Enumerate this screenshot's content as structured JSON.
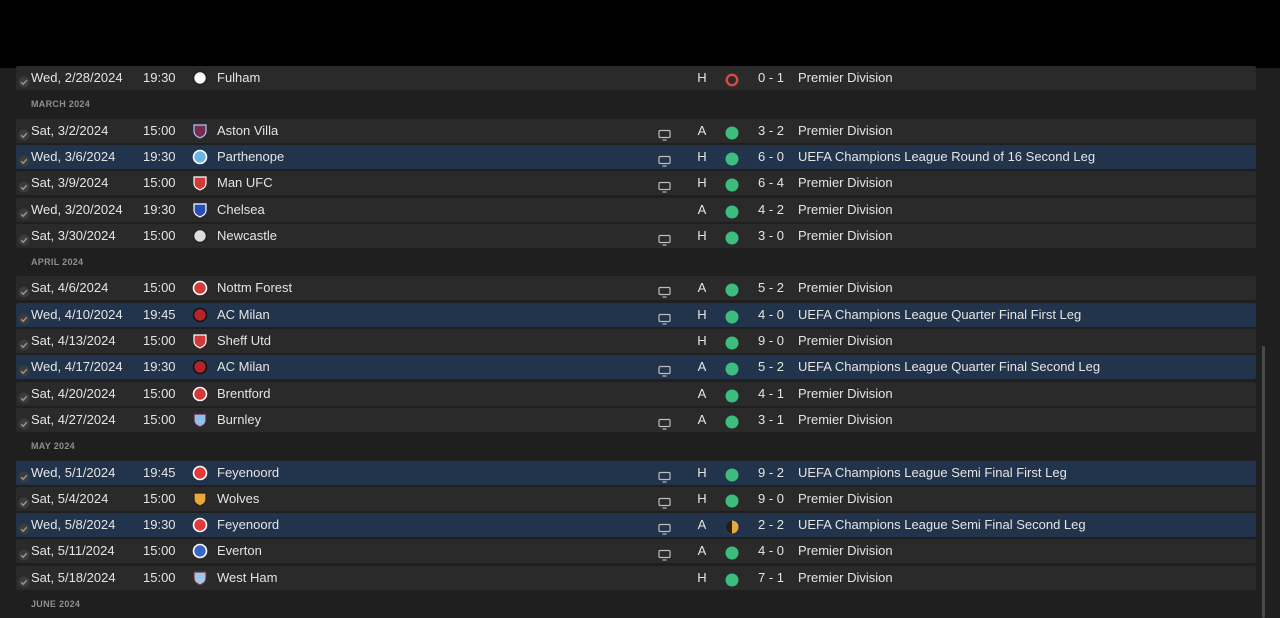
{
  "colors": {
    "win": "#3dbd7d",
    "draw": "#e6a93a",
    "loss": "#d24a4a",
    "row": "#2a2a2a",
    "row_highlight": "#22344c"
  },
  "entries": [
    {
      "kind": "match",
      "date": "Wed, 2/28/2024",
      "time": "19:30",
      "team": "Fulham",
      "crest": {
        "type": "circle",
        "fill": "#ffffff",
        "stroke": "#222222"
      },
      "tv": false,
      "venue": "H",
      "result": "loss",
      "score": "0 - 1",
      "competition": "Premier Division",
      "highlight": false
    },
    {
      "kind": "month",
      "label": "MARCH 2024"
    },
    {
      "kind": "match",
      "date": "Sat, 3/2/2024",
      "time": "15:00",
      "team": "Aston Villa",
      "crest": {
        "type": "shield",
        "fill": "#7a2a4a",
        "stroke": "#a8c8ff"
      },
      "tv": true,
      "venue": "A",
      "result": "win",
      "score": "3 - 2",
      "competition": "Premier Division",
      "highlight": false
    },
    {
      "kind": "match",
      "date": "Wed, 3/6/2024",
      "time": "19:30",
      "team": "Parthenope",
      "crest": {
        "type": "circle",
        "fill": "#6ab6e6",
        "stroke": "#ffffff"
      },
      "tv": true,
      "venue": "H",
      "result": "win",
      "score": "6 - 0",
      "competition": "UEFA Champions League Round of 16 Second Leg",
      "highlight": true
    },
    {
      "kind": "match",
      "date": "Sat, 3/9/2024",
      "time": "15:00",
      "team": "Man UFC",
      "crest": {
        "type": "shield",
        "fill": "#d23a3a",
        "stroke": "#ffffff"
      },
      "tv": true,
      "venue": "H",
      "result": "win",
      "score": "6 - 4",
      "competition": "Premier Division",
      "highlight": false
    },
    {
      "kind": "match",
      "date": "Wed, 3/20/2024",
      "time": "19:30",
      "team": "Chelsea",
      "crest": {
        "type": "shield",
        "fill": "#2a4eb8",
        "stroke": "#ffffff"
      },
      "tv": false,
      "venue": "A",
      "result": "win",
      "score": "4 - 2",
      "competition": "Premier Division",
      "highlight": false
    },
    {
      "kind": "match",
      "date": "Sat, 3/30/2024",
      "time": "15:00",
      "team": "Newcastle",
      "crest": {
        "type": "circle",
        "fill": "#dddddd",
        "stroke": "#222222"
      },
      "tv": true,
      "venue": "H",
      "result": "win",
      "score": "3 - 0",
      "competition": "Premier Division",
      "highlight": false
    },
    {
      "kind": "month",
      "label": "APRIL 2024"
    },
    {
      "kind": "match",
      "date": "Sat, 4/6/2024",
      "time": "15:00",
      "team": "Nottm Forest",
      "crest": {
        "type": "circle",
        "fill": "#d23a3a",
        "stroke": "#ffffff"
      },
      "tv": true,
      "venue": "A",
      "result": "win",
      "score": "5 - 2",
      "competition": "Premier Division",
      "highlight": false
    },
    {
      "kind": "match",
      "date": "Wed, 4/10/2024",
      "time": "19:45",
      "team": "AC Milan",
      "crest": {
        "type": "circle",
        "fill": "#b8232a",
        "stroke": "#111111"
      },
      "tv": true,
      "venue": "H",
      "result": "win",
      "score": "4 - 0",
      "competition": "UEFA Champions League Quarter Final First Leg",
      "highlight": true
    },
    {
      "kind": "match",
      "date": "Sat, 4/13/2024",
      "time": "15:00",
      "team": "Sheff Utd",
      "crest": {
        "type": "shield",
        "fill": "#d23a3a",
        "stroke": "#ffffff"
      },
      "tv": false,
      "venue": "H",
      "result": "win",
      "score": "9 - 0",
      "competition": "Premier Division",
      "highlight": false
    },
    {
      "kind": "match",
      "date": "Wed, 4/17/2024",
      "time": "19:30",
      "team": "AC Milan",
      "crest": {
        "type": "circle",
        "fill": "#b8232a",
        "stroke": "#111111"
      },
      "tv": true,
      "venue": "A",
      "result": "win",
      "score": "5 - 2",
      "competition": "UEFA Champions League Quarter Final Second Leg",
      "highlight": true
    },
    {
      "kind": "match",
      "date": "Sat, 4/20/2024",
      "time": "15:00",
      "team": "Brentford",
      "crest": {
        "type": "circle",
        "fill": "#d23a3a",
        "stroke": "#ffffff"
      },
      "tv": false,
      "venue": "A",
      "result": "win",
      "score": "4 - 1",
      "competition": "Premier Division",
      "highlight": false
    },
    {
      "kind": "match",
      "date": "Sat, 4/27/2024",
      "time": "15:00",
      "team": "Burnley",
      "crest": {
        "type": "shield",
        "fill": "#8ec0e8",
        "stroke": "#6a1f3a"
      },
      "tv": true,
      "venue": "A",
      "result": "win",
      "score": "3 - 1",
      "competition": "Premier Division",
      "highlight": false
    },
    {
      "kind": "month",
      "label": "MAY 2024"
    },
    {
      "kind": "match",
      "date": "Wed, 5/1/2024",
      "time": "19:45",
      "team": "Feyenoord",
      "crest": {
        "type": "circle",
        "fill": "#e23a3a",
        "stroke": "#ffffff"
      },
      "tv": true,
      "venue": "H",
      "result": "win",
      "score": "9 - 2",
      "competition": "UEFA Champions League Semi Final First Leg",
      "highlight": true
    },
    {
      "kind": "match",
      "date": "Sat, 5/4/2024",
      "time": "15:00",
      "team": "Wolves",
      "crest": {
        "type": "shield",
        "fill": "#e8a83a",
        "stroke": "#222222"
      },
      "tv": true,
      "venue": "H",
      "result": "win",
      "score": "9 - 0",
      "competition": "Premier Division",
      "highlight": false
    },
    {
      "kind": "match",
      "date": "Wed, 5/8/2024",
      "time": "19:30",
      "team": "Feyenoord",
      "crest": {
        "type": "circle",
        "fill": "#e23a3a",
        "stroke": "#ffffff"
      },
      "tv": true,
      "venue": "A",
      "result": "draw",
      "score": "2 - 2",
      "competition": "UEFA Champions League Semi Final Second Leg",
      "highlight": true
    },
    {
      "kind": "match",
      "date": "Sat, 5/11/2024",
      "time": "15:00",
      "team": "Everton",
      "crest": {
        "type": "circle",
        "fill": "#3a66c8",
        "stroke": "#ffffff"
      },
      "tv": true,
      "venue": "A",
      "result": "win",
      "score": "4 - 0",
      "competition": "Premier Division",
      "highlight": false
    },
    {
      "kind": "match",
      "date": "Sat, 5/18/2024",
      "time": "15:00",
      "team": "West Ham",
      "crest": {
        "type": "shield",
        "fill": "#9ec8e8",
        "stroke": "#7a2a3a"
      },
      "tv": false,
      "venue": "H",
      "result": "win",
      "score": "7 - 1",
      "competition": "Premier Division",
      "highlight": false
    },
    {
      "kind": "month",
      "label": "JUNE 2024"
    }
  ]
}
